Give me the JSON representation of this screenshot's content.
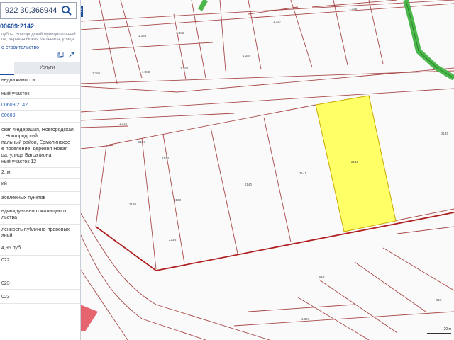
{
  "search": {
    "value": "922 30,366944"
  },
  "panel": {
    "cadastral_number": "00609:2142",
    "address_preview_1": "публь, Новгородский муниципальный",
    "address_preview_2": "ое, деревня Новая Мельница, улица...",
    "status": "о строительство",
    "tabs": [
      "",
      "Услуги"
    ],
    "rows": [
      {
        "text": "недвижимости",
        "link": false
      },
      {
        "text": "ный участок",
        "link": false
      },
      {
        "text": "00609:2142",
        "link": true
      },
      {
        "text": "00609",
        "link": true
      },
      {
        "text": "ская Федерация, Новгородская",
        "link": false
      },
      {
        "text": "., Новгородский",
        "link": false
      },
      {
        "text": "пальный район, Ермолинское",
        "link": false
      },
      {
        "text": "е поселение, деревня Новая",
        "link": false
      },
      {
        "text": "ца, улица Багратиона,",
        "link": false
      },
      {
        "text": "ный участок 12",
        "link": false
      },
      {
        "text": "2, м",
        "link": false
      },
      {
        "text": "ий",
        "link": false
      },
      {
        "text": "аселённых пунктов",
        "link": false
      },
      {
        "text": "ндивидуального жилищного",
        "link": false
      },
      {
        "text": "льства",
        "link": false
      },
      {
        "text": "ленность публично-правовых",
        "link": false
      },
      {
        "text": "аний",
        "link": false
      },
      {
        "text": "4,95 руб.",
        "link": false
      },
      {
        "text": "022",
        "link": false
      },
      {
        "text": "023",
        "link": false
      },
      {
        "text": "023",
        "link": false
      }
    ]
  },
  "map": {
    "parcel_labels": [
      "1:388",
      "1:382",
      "1:383",
      "1:384",
      "1:385",
      "1:386",
      "1:387",
      "1:389",
      "2140",
      "2139",
      "2138",
      "2140",
      "2141",
      "2142",
      "2136",
      "2143",
      "2145",
      "813",
      "1:397",
      "910",
      "1:422"
    ],
    "scale_label": "20 м",
    "colors": {
      "boundary": "#a0262a",
      "selected_fill": "#ffff66",
      "selected_stroke": "#c9a800",
      "green_path": "#4cb84c",
      "red_zone": "#e6646e"
    }
  }
}
